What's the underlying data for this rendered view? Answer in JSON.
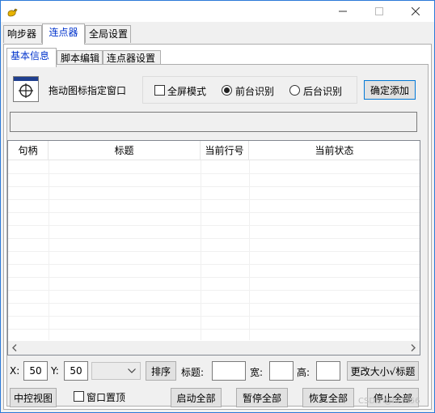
{
  "window": {
    "app_icon": "duck-icon",
    "controls": {
      "minimize": "minimize-icon",
      "maximize": "maximize-icon",
      "close": "close-icon"
    }
  },
  "top_tabs": [
    {
      "label": "响步器",
      "active": false
    },
    {
      "label": "连点器",
      "active": true
    },
    {
      "label": "全局设置",
      "active": false
    }
  ],
  "inner_tabs": [
    {
      "label": "基本信息",
      "active": true
    },
    {
      "label": "脚本编辑",
      "active": false
    },
    {
      "label": "连点器设置",
      "active": false
    }
  ],
  "finder": {
    "icon": "crosshair-target-icon",
    "hint": "拖动图标指定窗口"
  },
  "mode_options": {
    "fullscreen_label": "全屏模式",
    "fullscreen_checked": false,
    "radios": [
      {
        "label": "前台识别",
        "selected": true
      },
      {
        "label": "后台识别",
        "selected": false
      }
    ]
  },
  "confirm_add_label": "确定添加",
  "status_text": "",
  "table": {
    "columns": [
      "句柄",
      "标题",
      "当前行号",
      "当前状态"
    ],
    "rows": []
  },
  "position": {
    "x_label": "X:",
    "x_value": "50",
    "y_label": "Y:",
    "y_value": "50",
    "combo_value": "",
    "sort_label": "排序",
    "title_label": "标题:",
    "title_value": "",
    "width_label": "宽:",
    "width_value": "",
    "height_label": "高:",
    "height_value": "",
    "resize_label": "更改大小√标题"
  },
  "bottom": {
    "control_view_label": "中控视图",
    "window_top_label": "窗口置顶",
    "window_top_checked": false,
    "start_all_label": "启动全部",
    "pause_all_label": "暂停全部",
    "resume_all_label": "恢复全部",
    "stop_all_label": "停止全部"
  },
  "watermark": "CSDN @hct356"
}
